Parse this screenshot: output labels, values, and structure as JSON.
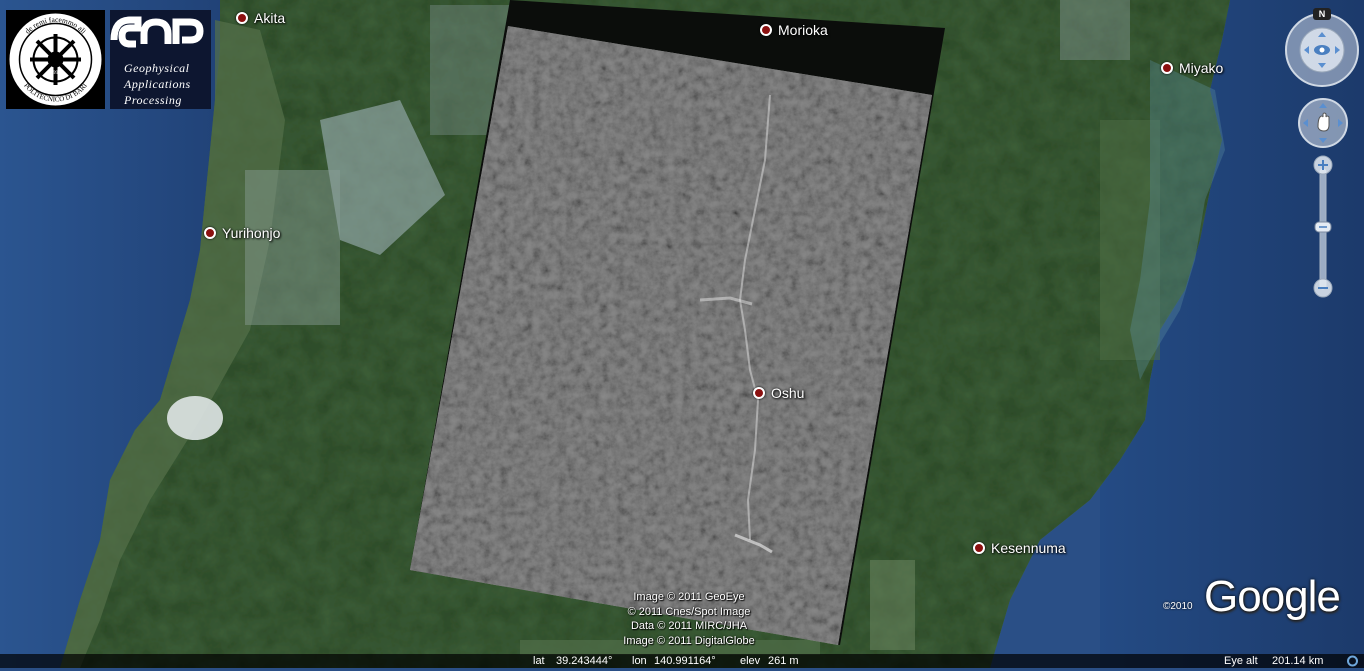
{
  "logos": {
    "poliba_line1": "de remi facemmo ali",
    "poliba_line2": "POLITECNICO DI BARI",
    "poliba_year": "1990",
    "gap_mark": "GAP",
    "gap_line1": "Geophysical",
    "gap_line2": "Applications",
    "gap_line3": "Processing"
  },
  "places": [
    {
      "name": "Akita"
    },
    {
      "name": "Morioka"
    },
    {
      "name": "Miyako"
    },
    {
      "name": "Yurihonjo"
    },
    {
      "name": "Oshu"
    },
    {
      "name": "Kesennuma"
    }
  ],
  "credits": [
    "Image © 2011 GeoEye",
    "© 2011 Cnes/Spot Image",
    "Data © 2011 MIRC/JHA",
    "Image © 2011 DigitalGlobe"
  ],
  "brand": {
    "copyright": "©2010",
    "name": "Google"
  },
  "status": {
    "lat_label": "lat",
    "lat": "39.243444°",
    "lon_label": "lon",
    "lon": "140.991164°",
    "elev_label": "elev",
    "elev": "261 m",
    "eye_label": "Eye alt",
    "eye": "201.14 km"
  },
  "controls": {
    "compass_north": "N"
  },
  "colors": {
    "ocean": "#2a4f86",
    "land": "#3a5a34",
    "sar_overlay": "#6e6e6e",
    "city_dot": "#8b1010"
  }
}
